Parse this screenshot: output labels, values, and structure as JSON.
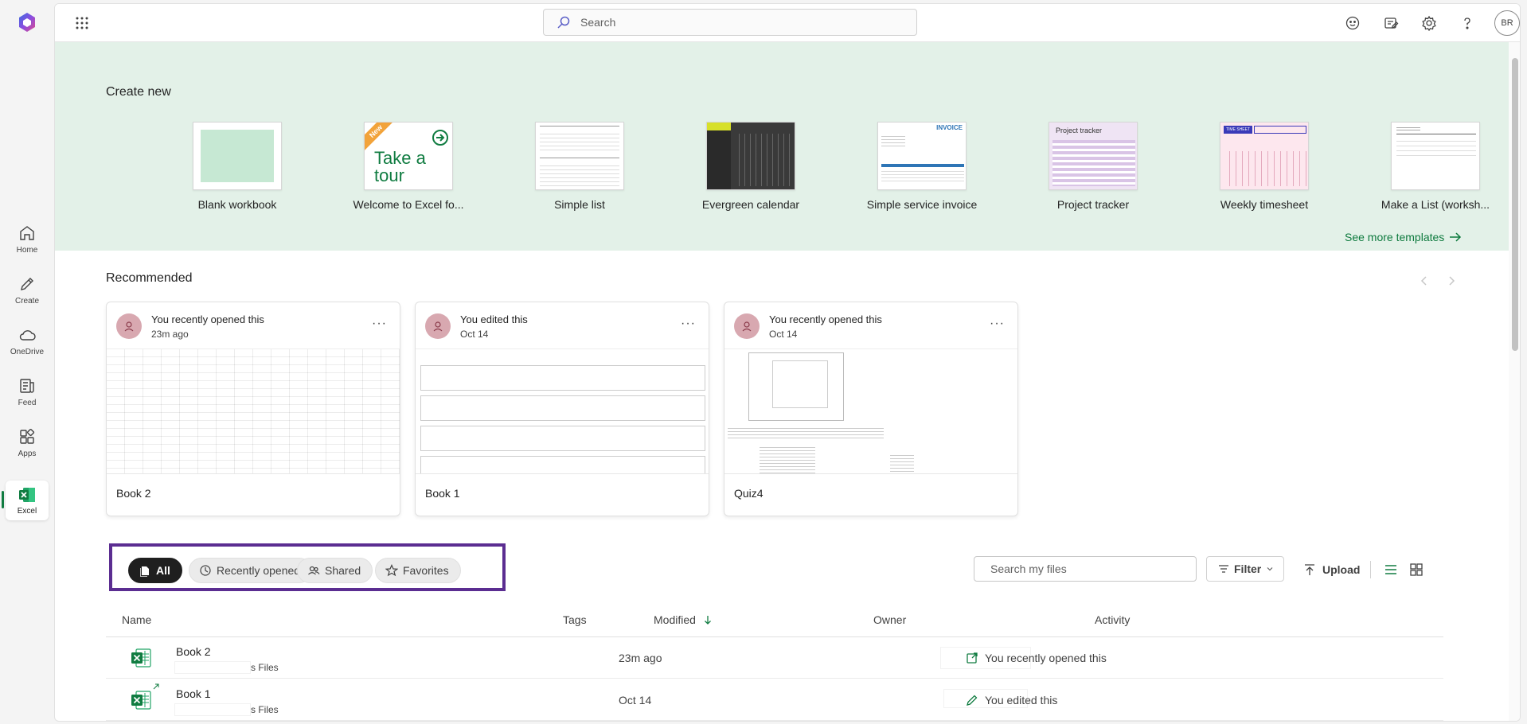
{
  "rail": {
    "items": [
      {
        "label": "Home",
        "icon": "home-icon"
      },
      {
        "label": "Create",
        "icon": "pencil-icon"
      },
      {
        "label": "OneDrive",
        "icon": "cloud-icon"
      },
      {
        "label": "Feed",
        "icon": "feed-icon"
      },
      {
        "label": "Apps",
        "icon": "apps-icon"
      }
    ],
    "excel_label": "Excel"
  },
  "topbar": {
    "search_placeholder": "Search",
    "avatar_initials": "BR"
  },
  "create": {
    "title": "Create new",
    "templates": [
      {
        "name": "Blank workbook"
      },
      {
        "name": "Welcome to Excel fo...",
        "badge": "New",
        "thumb_text": "Take a tour"
      },
      {
        "name": "Simple list"
      },
      {
        "name": "Evergreen calendar"
      },
      {
        "name": "Simple service invoice",
        "thumb_text": "INVOICE"
      },
      {
        "name": "Project tracker",
        "thumb_text": "Project tracker"
      },
      {
        "name": "Weekly timesheet",
        "thumb_text": "TIME SHEET"
      },
      {
        "name": "Make a List (worksh..."
      }
    ],
    "see_more": "See more templates"
  },
  "recommended": {
    "title": "Recommended",
    "cards": [
      {
        "activity": "You recently opened this",
        "when": "23m ago",
        "name": "Book 2"
      },
      {
        "activity": "You edited this",
        "when": "Oct 14",
        "name": "Book 1"
      },
      {
        "activity": "You recently opened this",
        "when": "Oct 14",
        "name": "Quiz4"
      }
    ]
  },
  "filters": {
    "pills": [
      {
        "label": "All",
        "active": true
      },
      {
        "label": "Recently opened",
        "active": false
      },
      {
        "label": "Shared",
        "active": false
      },
      {
        "label": "Favorites",
        "active": false
      }
    ],
    "search_placeholder": "Search my files",
    "filter_label": "Filter",
    "upload_label": "Upload"
  },
  "table": {
    "columns": [
      "Name",
      "Tags",
      "Modified",
      "Owner",
      "Activity"
    ],
    "rows": [
      {
        "name": "Book 2",
        "location": "s Files",
        "modified": "23m ago",
        "activity": "You recently opened this"
      },
      {
        "name": "Book 1",
        "location": "s Files",
        "modified": "Oct 14",
        "activity": "You edited this"
      }
    ]
  },
  "colors": {
    "accent_green": "#107c41",
    "highlight_purple": "#5b2d91",
    "create_bg": "#e3f1e8"
  }
}
